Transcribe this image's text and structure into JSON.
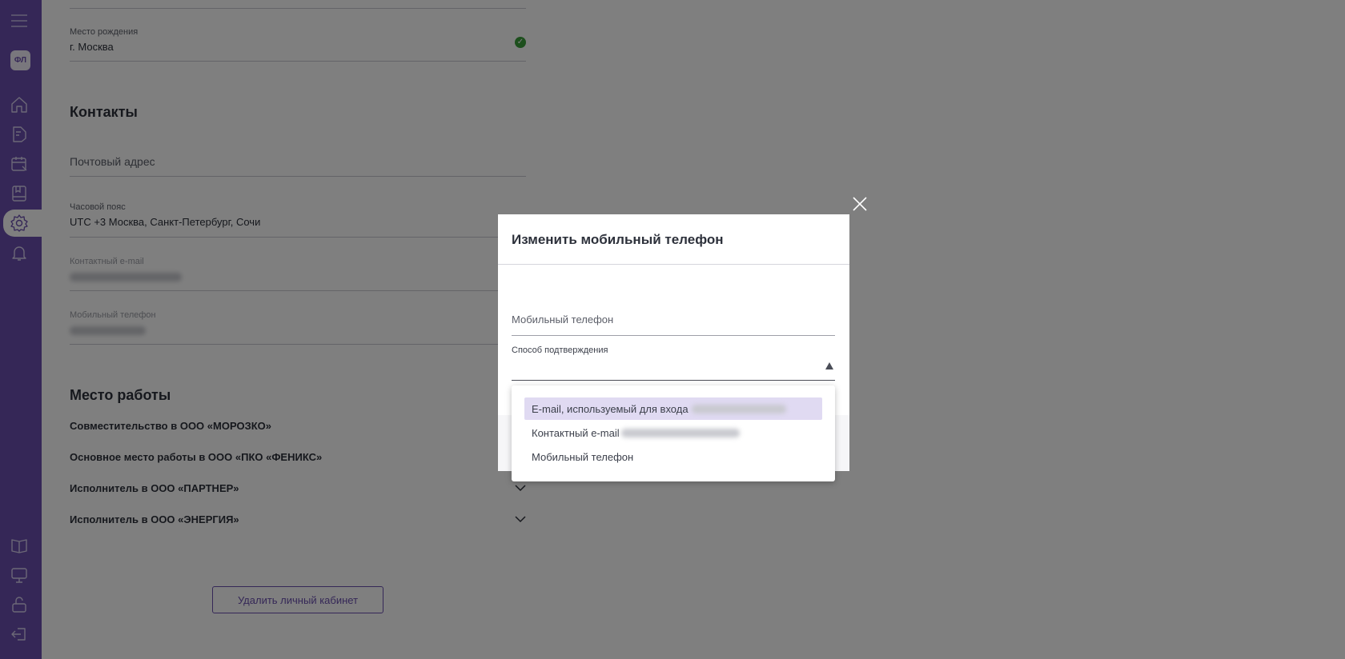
{
  "sidebar": {
    "avatar_label": "ФЛ",
    "nav_icons": [
      "menu-icon",
      "home-icon",
      "document-icon",
      "calendar-icon",
      "book-icon",
      "gear-icon",
      "bell-icon"
    ],
    "bottom_icons": [
      "open-book-icon",
      "presentation-icon",
      "unlock-icon",
      "logout-icon"
    ],
    "accent_color": "#6a4fae"
  },
  "profile": {
    "birthplace": {
      "label": "Место рождения",
      "value": "г. Москва"
    },
    "contacts_heading": "Контакты",
    "postal_address": {
      "placeholder": "Почтовый адрес"
    },
    "timezone": {
      "label": "Часовой пояс",
      "value": "UTC +3 Москва, Санкт-Петербург, Сочи"
    },
    "contact_email": {
      "label": "Контактный e-mail"
    },
    "mobile_phone": {
      "label": "Мобильный телефон"
    },
    "work_heading": "Место работы",
    "workplaces": [
      "Совместительство в ООО «МОРОЗКО»",
      "Основное место работы в ООО «ПКО «ФЕНИКС»",
      "Исполнитель в ООО «ПАРТНЕР»",
      "Исполнитель в ООО «ЭНЕРГИЯ»"
    ],
    "delete_button": "Удалить личный кабинет"
  },
  "modal": {
    "title": "Изменить мобильный телефон",
    "phone_field_label": "Мобильный телефон",
    "method_label": "Способ подтверждения",
    "options": [
      "E-mail, используемый для входа",
      "Контактный e-mail",
      "Мобильный телефон"
    ]
  }
}
